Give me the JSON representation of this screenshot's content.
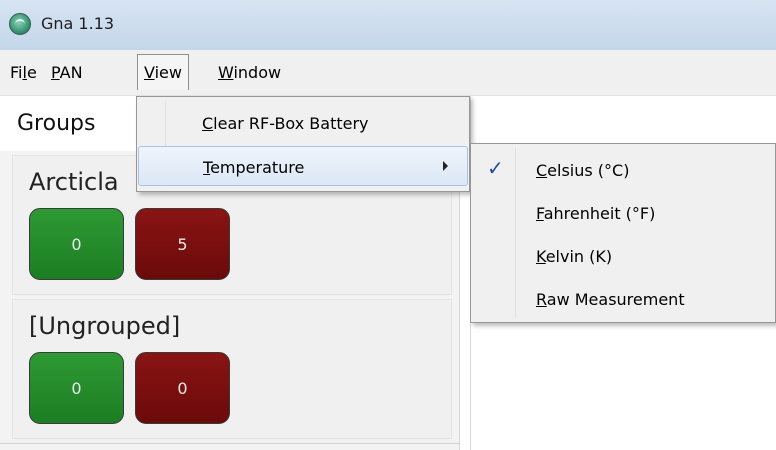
{
  "window": {
    "title": "Gna 1.13",
    "icon": "app-globe-icon"
  },
  "menubar": {
    "file": {
      "pre": "Fi",
      "u": "l",
      "post": "e"
    },
    "pan": {
      "pre": "",
      "u": "P",
      "post": "AN"
    },
    "view": {
      "pre": "",
      "u": "V",
      "post": "iew"
    },
    "window": {
      "pre": "",
      "u": "W",
      "post": "indow"
    }
  },
  "main": {
    "groups_label": "Groups",
    "groups": [
      {
        "name": "Arcticla",
        "green_count": "0",
        "red_count": "5"
      },
      {
        "name": "[Ungrouped]",
        "green_count": "0",
        "red_count": "0"
      }
    ]
  },
  "view_menu": {
    "items": [
      {
        "u": "C",
        "rest": "lear RF-Box Battery"
      },
      {
        "u": "T",
        "rest": "emperature",
        "has_submenu": true
      }
    ]
  },
  "temperature_menu": {
    "items": [
      {
        "u": "C",
        "rest": "elsius (°C)",
        "checked": true
      },
      {
        "u": "F",
        "rest": "ahrenheit (°F)",
        "checked": false
      },
      {
        "u": "K",
        "rest": "elvin (K)",
        "checked": false
      },
      {
        "u": "R",
        "rest": "aw Measurement",
        "checked": false
      }
    ],
    "check_glyph": "✓"
  },
  "colors": {
    "ok_green": "#1c7d23",
    "alert_red": "#6b0a0a",
    "highlight_blue": "#dce8f6"
  }
}
